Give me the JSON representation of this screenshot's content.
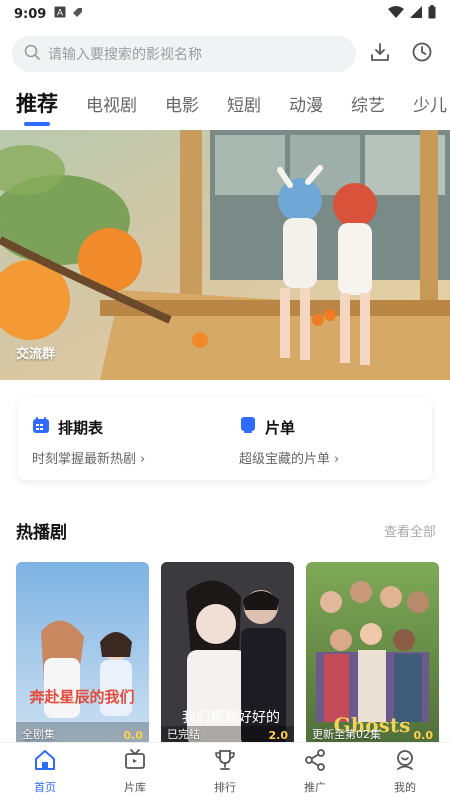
{
  "status_bar": {
    "time": "9:09"
  },
  "search": {
    "placeholder": "请输入要搜索的影视名称"
  },
  "tabs": [
    {
      "label": "推荐",
      "active": true
    },
    {
      "label": "电视剧"
    },
    {
      "label": "电影"
    },
    {
      "label": "短剧"
    },
    {
      "label": "动漫"
    },
    {
      "label": "综艺"
    },
    {
      "label": "少儿"
    }
  ],
  "banner": {
    "label": "交流群"
  },
  "shortcuts": [
    {
      "title": "排期表",
      "subtitle": "时刻掌握最新热剧",
      "icon": "calendar-icon"
    },
    {
      "title": "片单",
      "subtitle": "超级宝藏的片单",
      "icon": "list-icon"
    }
  ],
  "section": {
    "title": "热播剧",
    "more": "查看全部"
  },
  "posters": [
    {
      "poster_text": "奔赴星辰的我们",
      "badge": "全剧集",
      "score": "0.0"
    },
    {
      "poster_text": "我们都要好好的",
      "badge": "已完结",
      "score": "2.0"
    },
    {
      "poster_text": "Ghosts",
      "badge": "更新至第02集",
      "score": "0.0"
    }
  ],
  "bottom_nav": [
    {
      "label": "首页",
      "active": true
    },
    {
      "label": "片库"
    },
    {
      "label": "排行"
    },
    {
      "label": "推广"
    },
    {
      "label": "我的"
    }
  ],
  "colors": {
    "accent": "#2f6bff"
  }
}
